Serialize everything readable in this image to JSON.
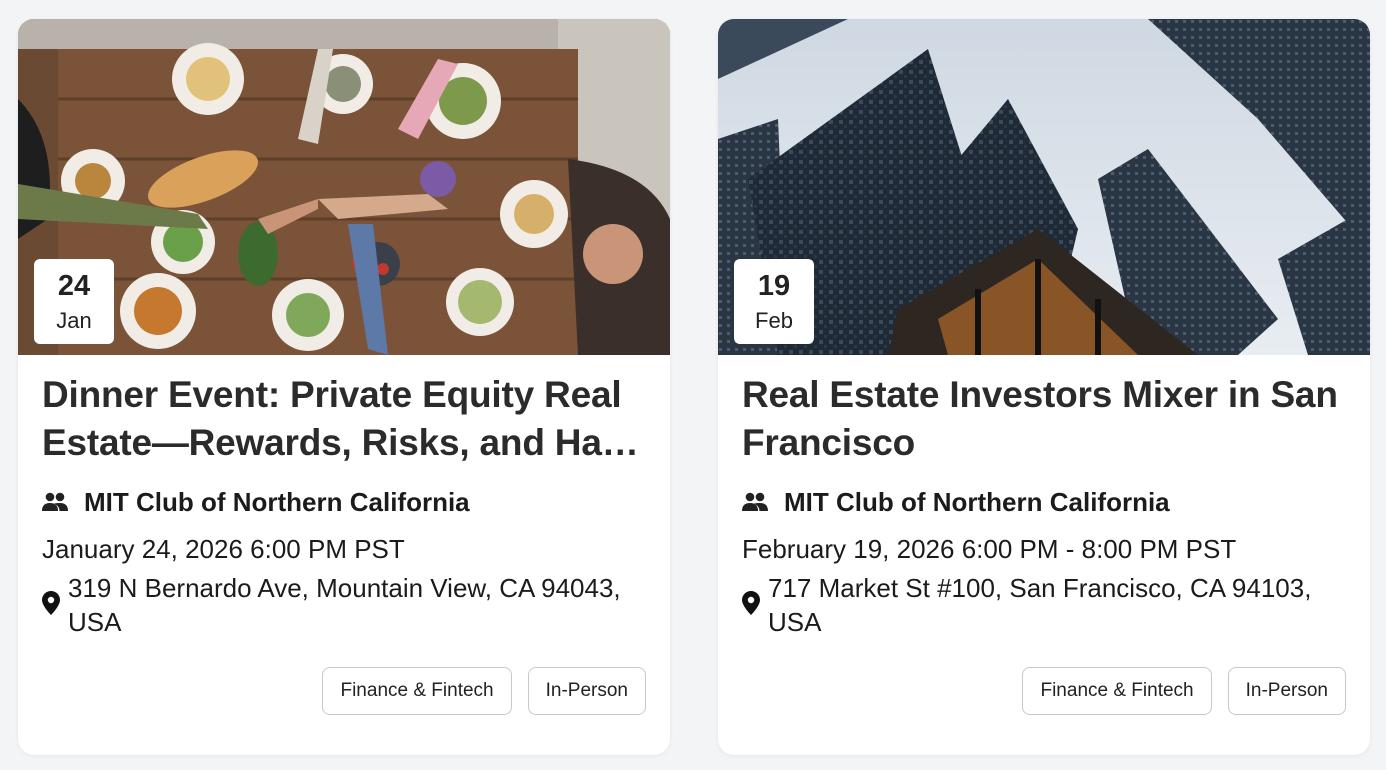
{
  "events": [
    {
      "date_day": "24",
      "date_month": "Jan",
      "title": "Dinner Event: Private Equity Real Estate—Rewards, Risks, and Hard Lessons",
      "organizer": "MIT Club of Northern California",
      "datetime": "January 24, 2026 6:00 PM PST",
      "address": "319 N Bernardo Ave, Mountain View, CA 94043, USA",
      "tags": [
        "Finance & Fintech",
        "In-Person"
      ],
      "image_icon": "dinner-table-photo"
    },
    {
      "date_day": "19",
      "date_month": "Feb",
      "title": "Real Estate Investors Mixer in San Francisco",
      "organizer": "MIT Club of Northern California",
      "datetime": "February 19, 2026 6:00 PM - 8:00 PM PST",
      "address": "717 Market St #100, San Francisco, CA 94103, USA",
      "tags": [
        "Finance & Fintech",
        "In-Person"
      ],
      "image_icon": "skyscrapers-photo"
    }
  ],
  "icons": {
    "organizer": "people-icon",
    "location": "location-pin-icon"
  },
  "colors": {
    "background": "#f3f4f6",
    "card": "#ffffff",
    "text": "#1b1b1b",
    "tag_border": "#c8c8c8"
  }
}
